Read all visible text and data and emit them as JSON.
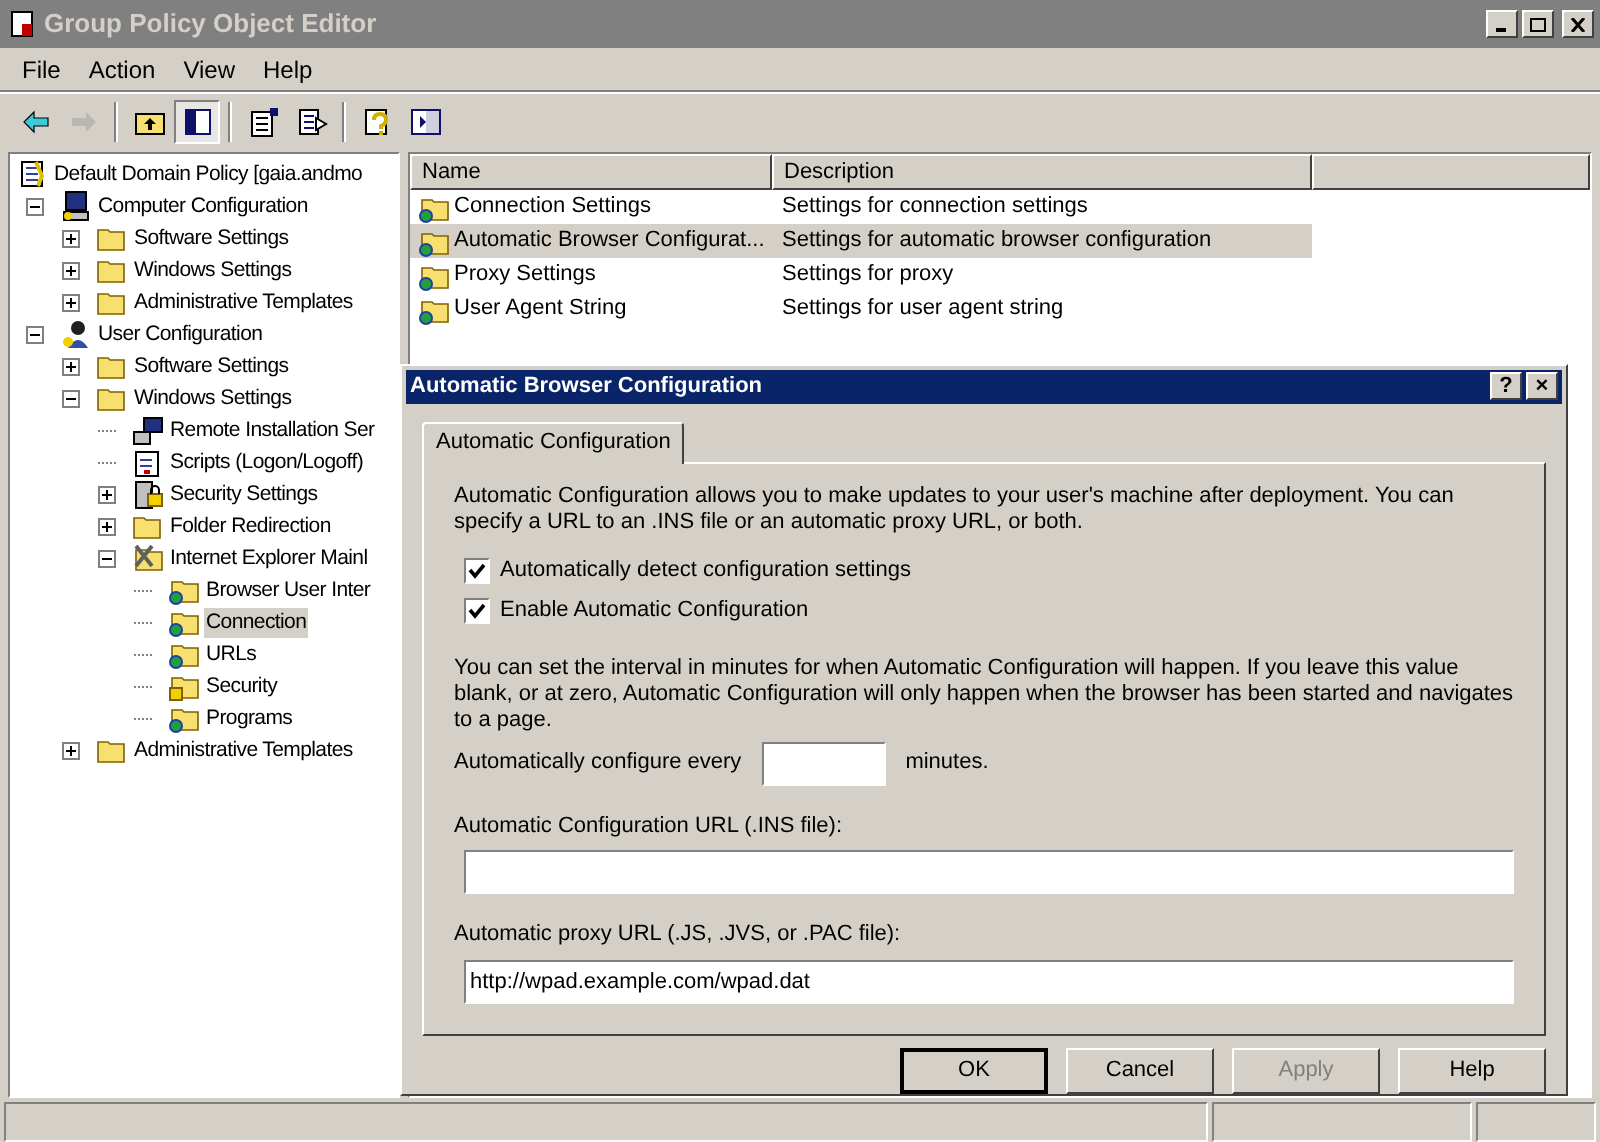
{
  "window": {
    "title": "Group Policy Object Editor"
  },
  "menu": [
    {
      "label": "File"
    },
    {
      "label": "Action"
    },
    {
      "label": "View"
    },
    {
      "label": "Help"
    }
  ],
  "toolbar": [
    {
      "kind": "back",
      "disabled": false
    },
    {
      "kind": "forward",
      "disabled": true
    },
    {
      "kind": "sep"
    },
    {
      "kind": "up",
      "disabled": false
    },
    {
      "kind": "tree",
      "disabled": false,
      "pressed": true
    },
    {
      "kind": "sep"
    },
    {
      "kind": "properties",
      "disabled": false
    },
    {
      "kind": "export",
      "disabled": false
    },
    {
      "kind": "sep"
    },
    {
      "kind": "help",
      "disabled": false
    },
    {
      "kind": "pane",
      "disabled": false
    }
  ],
  "tree": [
    {
      "label": "Default Domain Policy [gaia.andmo",
      "kind": "policy",
      "selected": false,
      "children": [
        {
          "label": "Computer Configuration",
          "kind": "computer",
          "expanded": true,
          "selected": false,
          "children": [
            {
              "label": "Software Settings",
              "kind": "folder",
              "expanded": false,
              "selected": false
            },
            {
              "label": "Windows Settings",
              "kind": "folder",
              "expanded": false,
              "selected": false
            },
            {
              "label": "Administrative Templates",
              "kind": "folder",
              "expanded": false,
              "selected": false
            }
          ]
        },
        {
          "label": "User Configuration",
          "kind": "user",
          "expanded": true,
          "selected": false,
          "children": [
            {
              "label": "Software Settings",
              "kind": "folder",
              "expanded": false,
              "selected": false
            },
            {
              "label": "Windows Settings",
              "kind": "folder",
              "expanded": true,
              "selected": false,
              "children": [
                {
                  "label": "Remote Installation Ser",
                  "kind": "remote",
                  "selected": false
                },
                {
                  "label": "Scripts (Logon/Logoff)",
                  "kind": "script",
                  "selected": false
                },
                {
                  "label": "Security Settings",
                  "kind": "security",
                  "expanded": false,
                  "selected": false
                },
                {
                  "label": "Folder Redirection",
                  "kind": "folder",
                  "expanded": false,
                  "selected": false
                },
                {
                  "label": "Internet Explorer Mainl",
                  "kind": "ie",
                  "expanded": true,
                  "selected": false,
                  "children": [
                    {
                      "label": "Browser User Inter",
                      "kind": "iefolder",
                      "selected": false
                    },
                    {
                      "label": "Connection",
                      "kind": "iefolder",
                      "selected": true
                    },
                    {
                      "label": "URLs",
                      "kind": "iefolder",
                      "selected": false
                    },
                    {
                      "label": "Security",
                      "kind": "lockfolder",
                      "selected": false
                    },
                    {
                      "label": "Programs",
                      "kind": "iefolder",
                      "selected": false
                    }
                  ]
                }
              ]
            },
            {
              "label": "Administrative Templates",
              "kind": "folder",
              "expanded": false,
              "selected": false
            }
          ]
        }
      ]
    }
  ],
  "list": {
    "columns": [
      "Name",
      "Description"
    ],
    "rows": [
      {
        "name": "Connection Settings",
        "description": "Settings for connection settings",
        "selected": false
      },
      {
        "name": "Automatic Browser Configurat...",
        "description": "Settings for automatic browser configuration",
        "selected": true
      },
      {
        "name": "Proxy Settings",
        "description": "Settings for proxy",
        "selected": false
      },
      {
        "name": "User Agent String",
        "description": "Settings for user agent string",
        "selected": false
      }
    ]
  },
  "dialog": {
    "title": "Automatic Browser Configuration",
    "title_buttons": [
      "?",
      "×"
    ],
    "tabs": [
      {
        "label": "Automatic Configuration",
        "selected": true
      }
    ],
    "intro": "Automatic Configuration allows you to make updates to your user's machine after deployment. You can specify a URL to an .INS file or an automatic proxy URL, or both.",
    "checkboxes": [
      {
        "label": "Automatically detect configuration settings",
        "checked": true
      },
      {
        "label": "Enable Automatic Configuration",
        "checked": true
      }
    ],
    "interval_note": "You can set the interval in minutes for when Automatic Configuration will happen. If you leave this value blank, or at zero, Automatic Configuration will only happen when the browser has been started and navigates to a page.",
    "interval": {
      "label": "Automatically configure every",
      "suffix": "minutes."
    },
    "ins_url": {
      "label": "Automatic Configuration URL (.INS file):"
    },
    "proxy_url": {
      "label": "Automatic proxy URL (.JS, .JVS, or .PAC file):",
      "value": "http://wpad.example.com/wpad.dat"
    },
    "buttons": [
      {
        "label": "OK",
        "default": true,
        "disabled": false
      },
      {
        "label": "Cancel",
        "default": false,
        "disabled": false
      },
      {
        "label": "Apply",
        "default": false,
        "disabled": true
      },
      {
        "label": "Help",
        "default": false,
        "disabled": false
      }
    ]
  }
}
